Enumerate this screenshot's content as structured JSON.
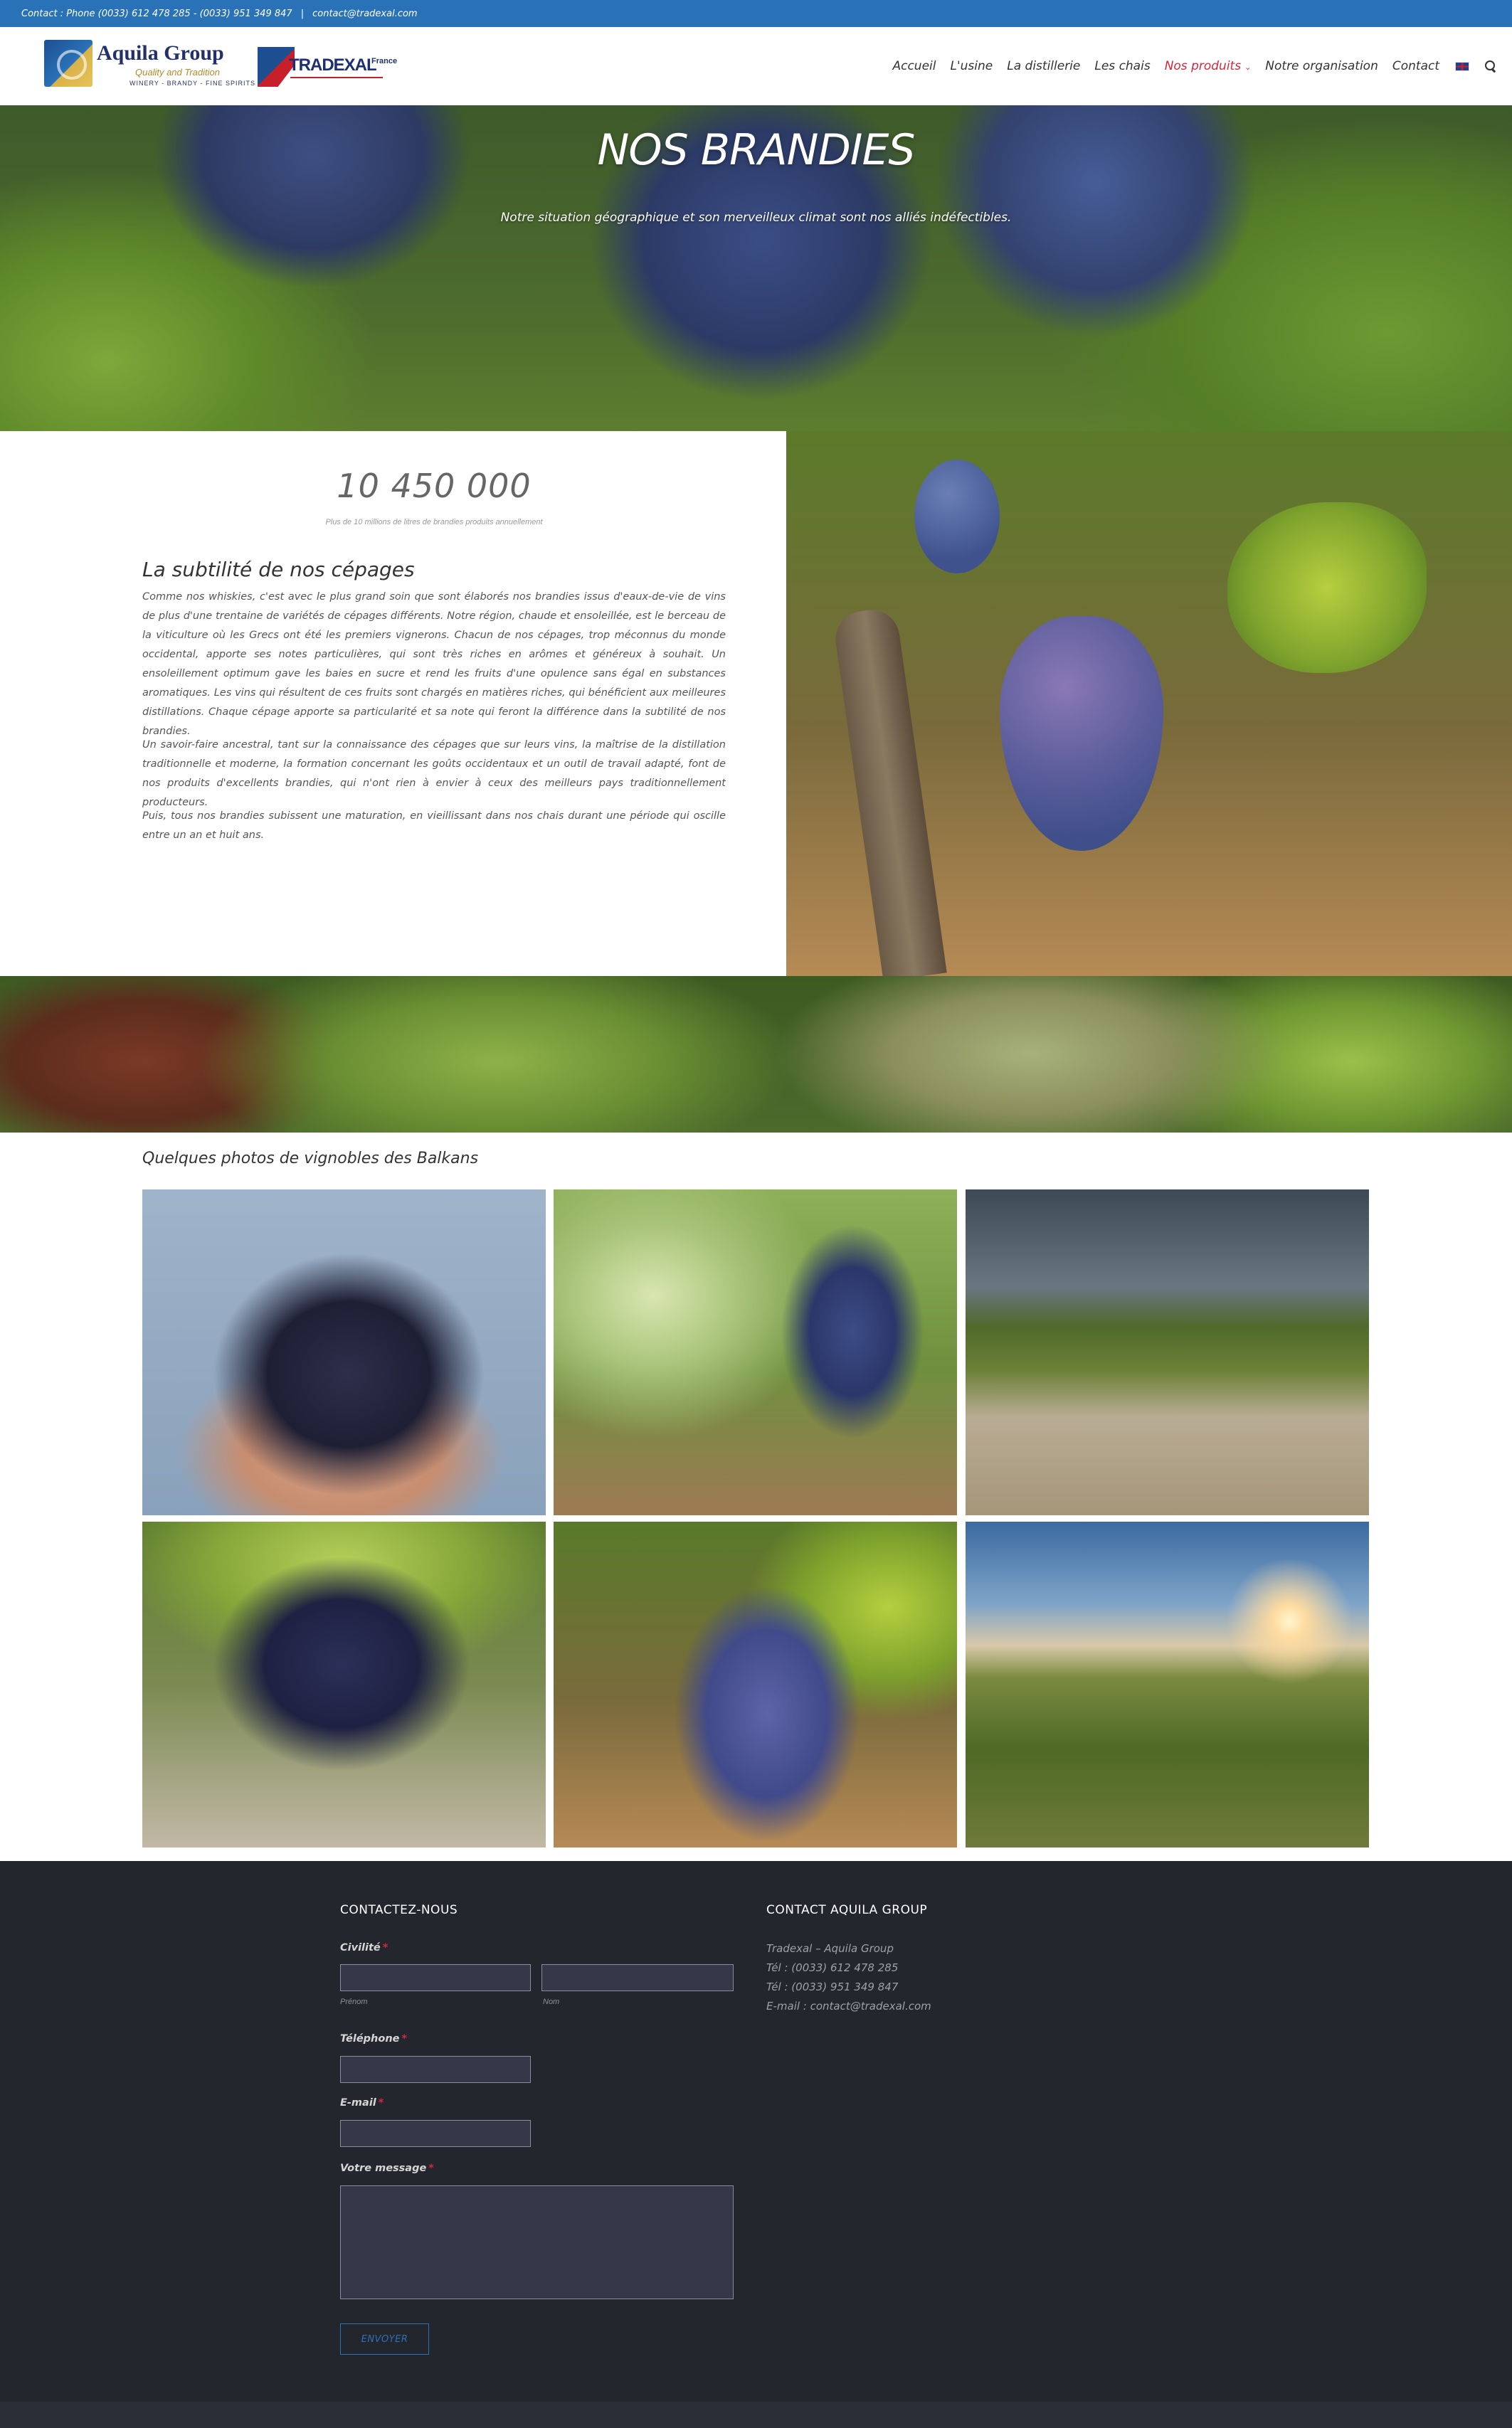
{
  "topbar": {
    "contact": "Contact : Phone (0033) 612 478 285 - (0033) 951 349 847",
    "separator": "|",
    "email": "contact@tradexal.com"
  },
  "header": {
    "logo_aquila": {
      "name": "Aquila Group",
      "tagline": "Quality and Tradition",
      "sub": "WINERY - BRANDY - FINE SPIRITS"
    },
    "logo_tradexal": {
      "name": "TRADEXAL",
      "suffix": "France"
    },
    "nav": [
      {
        "label": "Accueil"
      },
      {
        "label": "L'usine"
      },
      {
        "label": "La distillerie"
      },
      {
        "label": "Les chais"
      },
      {
        "label": "Nos produits",
        "active": true
      },
      {
        "label": "Notre organisation"
      },
      {
        "label": "Contact"
      }
    ],
    "flag_icon": "uk-flag-icon",
    "search_icon": "search-icon",
    "chevron": "⌄"
  },
  "hero": {
    "title": "NOS BRANDIES",
    "subtitle": "Notre situation géographique et son merveilleux climat sont nos alliés indéfectibles."
  },
  "intro": {
    "counter": "10 450 000",
    "counter_label": "Plus de 10 millions de litres de brandies produits annuellement",
    "heading": "La subtilité de nos cépages",
    "paragraphs": [
      "Comme nos whiskies, c'est avec le plus grand soin que sont élaborés nos brandies issus d'eaux-de-vie de vins de plus d'une trentaine de variétés de cépages différents. Notre région, chaude et ensoleillée, est le berceau de la viticulture où les Grecs ont été les premiers vignerons. Chacun de nos cépages, trop méconnus du monde occidental, apporte ses notes particulières, qui sont très riches en arômes et généreux à souhait. Un ensoleillement optimum gave les baies en sucre et rend les fruits d'une opulence sans égal en substances aromatiques. Les vins qui résultent de ces fruits sont chargés en matières riches, qui bénéficient aux meilleures distillations. Chaque cépage apporte sa particularité et sa note qui feront la différence dans la subtilité de nos brandies.",
      "Un savoir-faire ancestral, tant sur la connaissance des cépages que sur leurs vins, la maîtrise de la distillation traditionnelle et moderne, la formation concernant les goûts occidentaux et un outil de travail adapté, font de nos produits d'excellents brandies, qui n'ont rien à envier à ceux des meilleurs pays traditionnellement producteurs.",
      "Puis, tous nos brandies subissent une maturation, en vieillissant dans nos chais durant une période qui oscille entre un an et huit ans."
    ]
  },
  "gallery": {
    "title": "Quelques photos de vignobles des Balkans"
  },
  "footer": {
    "form_title": "CONTACTEZ-NOUS",
    "civilite_label": "Civilité",
    "required_mark": "*",
    "prenom_hint": "Prénom",
    "nom_hint": "Nom",
    "phone_label": "Téléphone",
    "email_label": "E-mail",
    "message_label": "Votre message",
    "submit_label": "ENVOYER",
    "contact_title": "CONTACT AQUILA GROUP",
    "contact_lines": [
      "Tradexal – Aquila Group",
      "Tél : (0033) 612 478 285",
      "Tél : (0033) 951 349 847",
      "E-mail : contact@tradexal.com"
    ]
  },
  "colors": {
    "topbar": "#2a72b8",
    "accent_red": "#d6263b",
    "footer_bg": "#24262e"
  }
}
